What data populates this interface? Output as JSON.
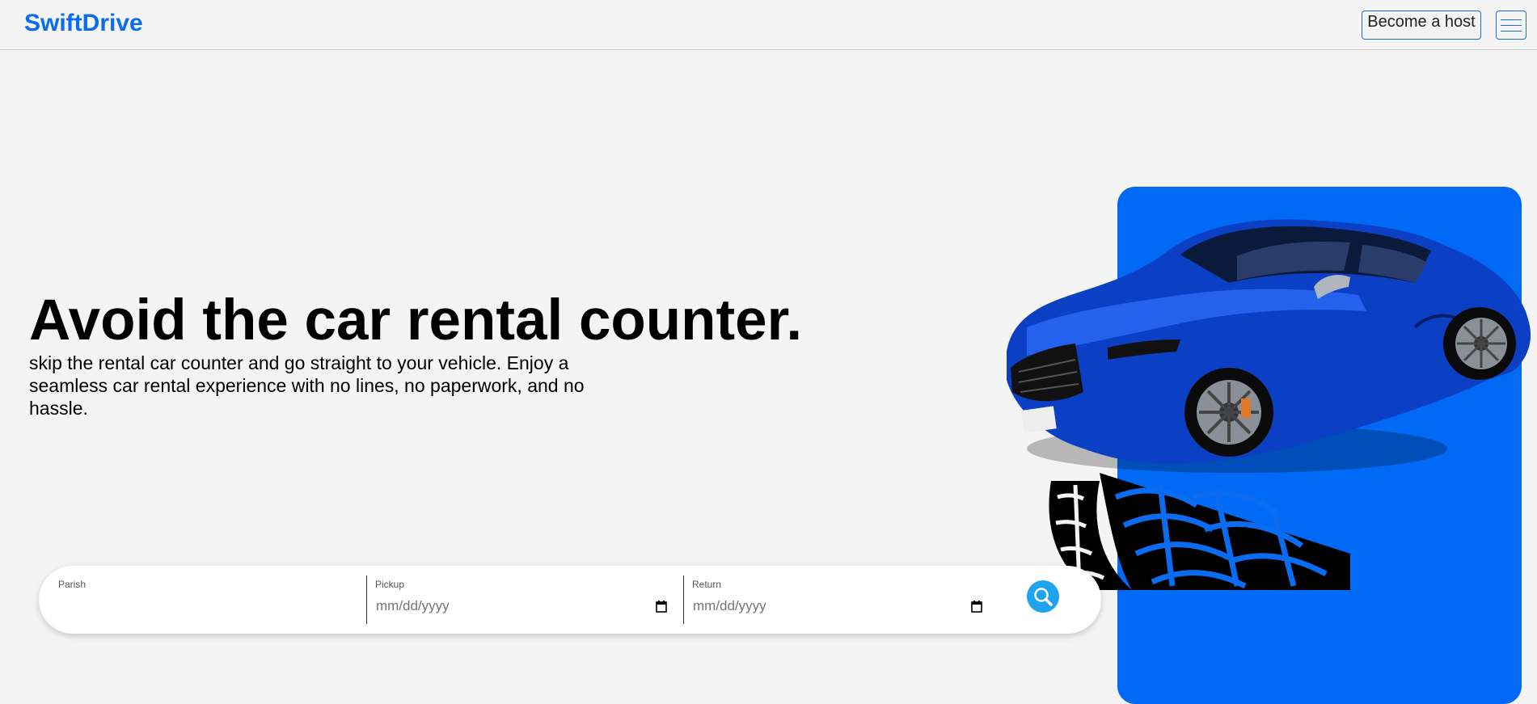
{
  "navbar": {
    "brand": "SwiftDrive",
    "become_host_label": "Become a host",
    "menu_icon": "hamburger-menu-icon"
  },
  "hero": {
    "title": "Avoid the car rental counter.",
    "subtitle": "skip the rental car counter and go straight to your vehicle. Enjoy a seamless car rental experience with no lines, no paperwork, and no hassle."
  },
  "search": {
    "parish": {
      "label": "Parish",
      "value": ""
    },
    "pickup": {
      "label": "Pickup",
      "placeholder": "mm/dd/yyyy"
    },
    "return": {
      "label": "Return",
      "placeholder": "mm/dd/yyyy"
    },
    "button_icon": "search-icon"
  },
  "colors": {
    "brand": "#0a6cf0",
    "panel": "#0069f5",
    "search_button": "#1fa2f0",
    "background": "#f4f4f4"
  },
  "images": {
    "hero_image": "blue-sports-sedan-with-tire-tracks"
  }
}
